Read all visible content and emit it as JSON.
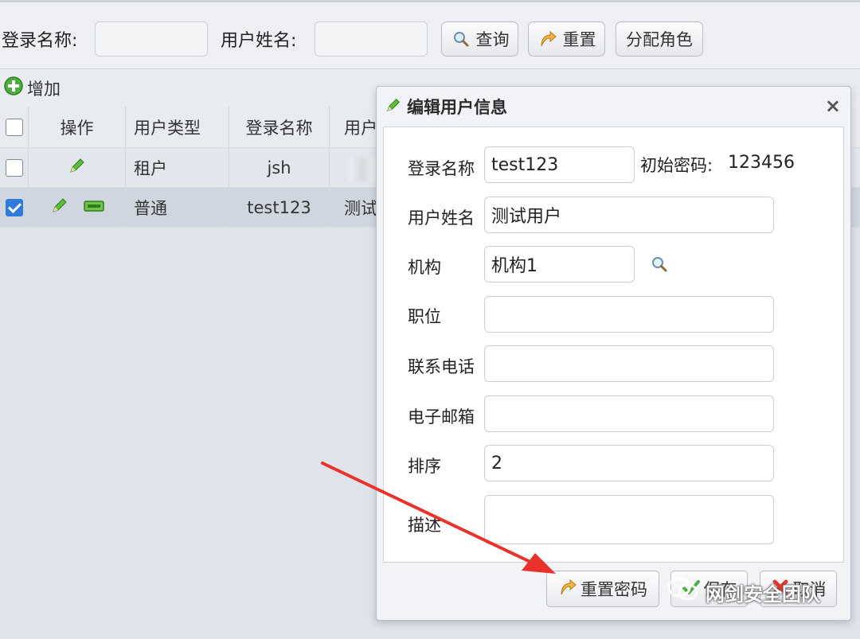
{
  "search": {
    "login_label": "登录名称:",
    "login_value": "",
    "name_label": "用户姓名:",
    "name_value": "",
    "query_label": "查询",
    "reset_label": "重置",
    "assign_role_label": "分配角色"
  },
  "toolbar": {
    "add_label": "增加"
  },
  "table": {
    "headers": {
      "ops": "操作",
      "user_type": "用户类型",
      "login_name": "登录名称",
      "user_name_partial": "用户"
    },
    "rows": [
      {
        "checked": false,
        "user_type": "租户",
        "login_name": "jsh",
        "user_name_partial": ""
      },
      {
        "checked": true,
        "user_type": "普通",
        "login_name": "test123",
        "user_name_partial": "测试"
      }
    ]
  },
  "dialog": {
    "title": "编辑用户信息",
    "close": "×",
    "fields": {
      "login_name": {
        "label": "登录名称",
        "value": "test123"
      },
      "init_password": {
        "label": "初始密码:",
        "value": "123456"
      },
      "user_name": {
        "label": "用户姓名",
        "value": "测试用户"
      },
      "org": {
        "label": "机构",
        "value": "机构1"
      },
      "position": {
        "label": "职位",
        "value": ""
      },
      "phone": {
        "label": "联系电话",
        "value": ""
      },
      "email": {
        "label": "电子邮箱",
        "value": ""
      },
      "sort": {
        "label": "排序",
        "value": "2"
      },
      "desc": {
        "label": "描述",
        "value": ""
      }
    },
    "buttons": {
      "reset_password": "重置密码",
      "save": "保存",
      "cancel": "取消"
    }
  },
  "watermark": {
    "text": "网剑安全团队"
  },
  "colors": {
    "accent_blue": "#2f7bd9",
    "arrow_red": "#e8322b",
    "edit_green": "#4caf3f"
  },
  "icons": [
    "search-icon",
    "reset-arrow-icon",
    "add-plus-icon",
    "edit-pencil-icon",
    "bar-icon",
    "magnifier-icon",
    "save-check-icon",
    "cancel-x-icon",
    "wechat-icon"
  ]
}
